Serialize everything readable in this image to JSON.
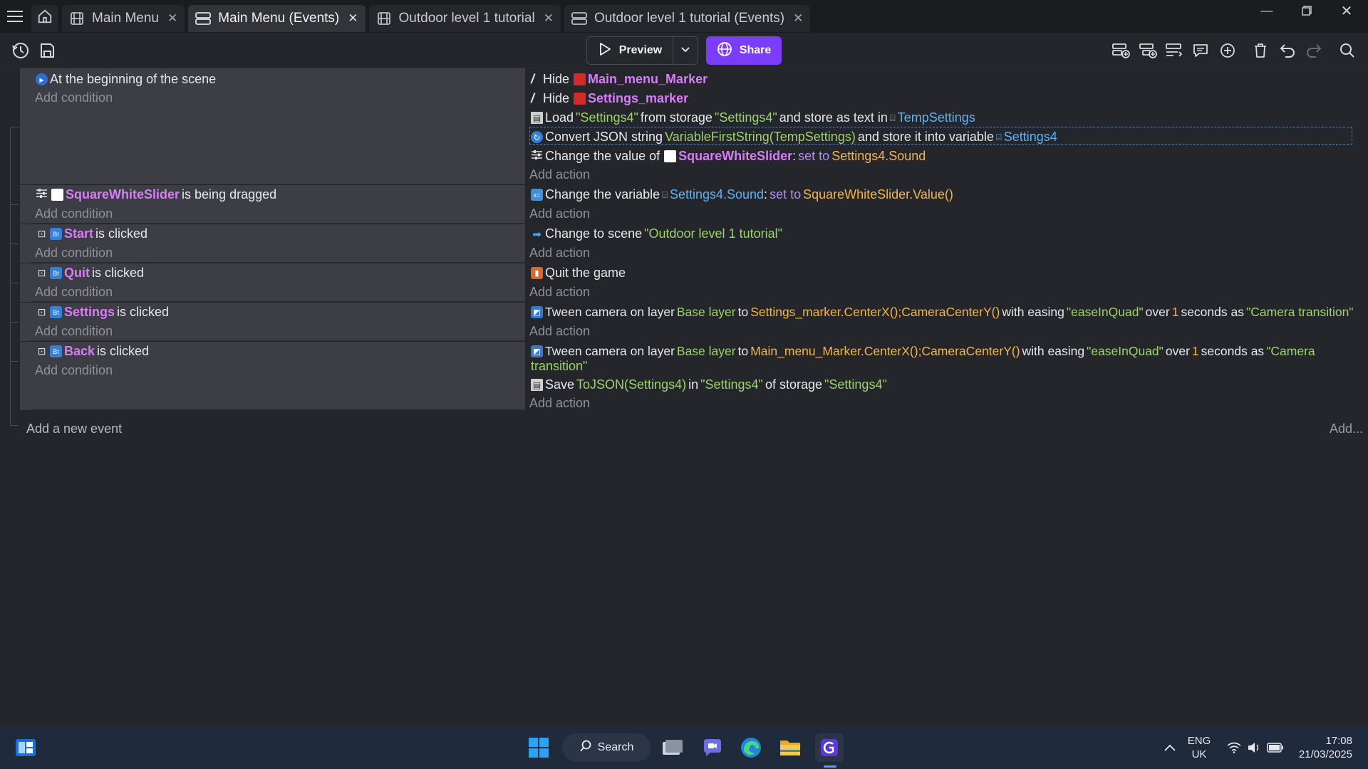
{
  "tabs": [
    {
      "label": "Main Menu",
      "active": false,
      "icon": "film-icon"
    },
    {
      "label": "Main Menu (Events)",
      "active": true,
      "icon": "events-icon"
    },
    {
      "label": "Outdoor level 1 tutorial",
      "active": false,
      "icon": "film-icon"
    },
    {
      "label": "Outdoor level 1 tutorial (Events)",
      "active": false,
      "icon": "events-icon"
    }
  ],
  "toolbar": {
    "preview_label": "Preview",
    "share_label": "Share"
  },
  "colors": {
    "accent": "#7b3dfa",
    "object": "#d77cf5",
    "string": "#9ad46a",
    "variable": "#5fb2f5",
    "expression": "#f3b54a",
    "marker_red": "#d22b2b"
  },
  "events": {
    "add_condition": "Add condition",
    "add_action": "Add action",
    "e1": {
      "cond": "At the beginning of the scene",
      "a1": {
        "verb": "Hide",
        "obj": "Main_menu_Marker"
      },
      "a2": {
        "verb": "Hide",
        "obj": "Settings_marker"
      },
      "a3": {
        "t1": "Load",
        "s1": "\"Settings4\"",
        "t2": "from storage",
        "s2": "\"Settings4\"",
        "t3": "and store as text in",
        "v1": "TempSettings"
      },
      "a4": {
        "t1": "Convert JSON string",
        "s1": "VariableFirstString(TempSettings)",
        "t2": "and store it into variable",
        "v1": "Settings4"
      },
      "a5": {
        "t1": "Change the value of",
        "obj": "SquareWhiteSlider",
        "colon": ":",
        "op": "set to",
        "e": "Settings4.Sound"
      }
    },
    "e2": {
      "obj": "SquareWhiteSlider",
      "cond": "is being dragged",
      "a1": {
        "t1": "Change the variable",
        "v1": "Settings4.Sound",
        "colon": ":",
        "op": "set to",
        "e": "SquareWhiteSlider.Value()"
      }
    },
    "e3": {
      "obj": "Start",
      "cond": "is clicked",
      "a1": {
        "t1": "Change to scene",
        "s1": "\"Outdoor level 1 tutorial\""
      }
    },
    "e4": {
      "obj": "Quit",
      "cond": "is clicked",
      "a1": {
        "t1": "Quit the game"
      }
    },
    "e5": {
      "obj": "Settings",
      "cond": "is clicked",
      "a1": {
        "t1": "Tween camera on layer",
        "s1": "Base layer",
        "t2": "to",
        "e": "Settings_marker.CenterX();CameraCenterY()",
        "t3": "with easing",
        "s2": "\"easeInQuad\"",
        "t4": "over",
        "n": "1",
        "t5": "seconds as",
        "s3": "\"Camera transition\""
      }
    },
    "e6": {
      "obj": "Back",
      "cond": "is clicked",
      "a1": {
        "t1": "Tween camera on layer",
        "s1": "Base layer",
        "t2": "to",
        "e": "Main_menu_Marker.CenterX();CameraCenterY()",
        "t3": "with easing",
        "s2": "\"easeInQuad\"",
        "t4": "over",
        "n": "1",
        "t5": "seconds as",
        "s3": "\"Camera",
        "s3b": "transition\""
      },
      "a2": {
        "t1": "Save",
        "s1": "ToJSON(Settings4)",
        "t2": "in",
        "s2": "\"Settings4\"",
        "t3": "of storage",
        "s3": "\"Settings4\""
      }
    },
    "add_new_event": "Add a new event",
    "add_more": "Add..."
  },
  "taskbar": {
    "search_label": "Search",
    "lang_top": "ENG",
    "lang_bottom": "UK",
    "time": "17:08",
    "date": "21/03/2025"
  }
}
